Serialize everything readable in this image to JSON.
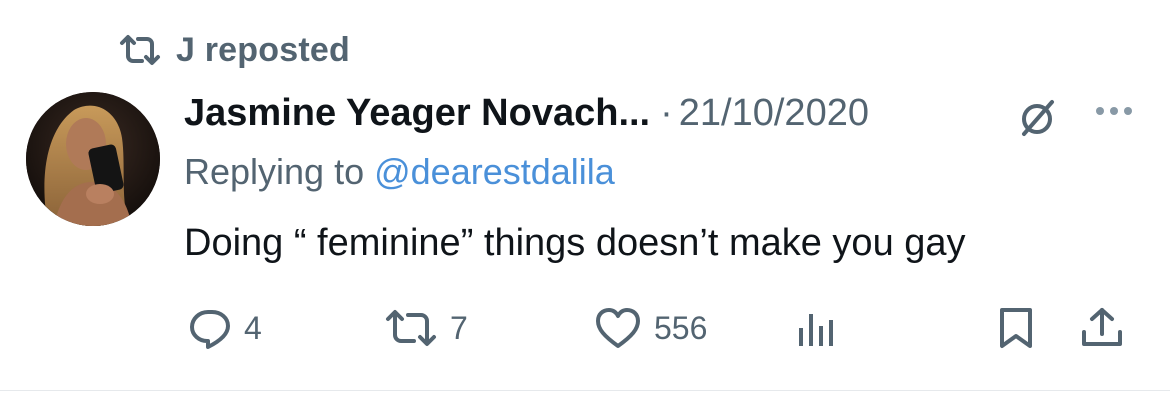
{
  "repost": {
    "label": "J reposted",
    "icon": "repost-icon"
  },
  "author": {
    "name": "Jasmine Yeager Novach...",
    "separator": "·",
    "date": "21/10/2020",
    "avatar": "avatar-photo",
    "badge_icon": "no-symbol-icon"
  },
  "reply": {
    "prefix": "Replying to",
    "handle": "@dearestdalila"
  },
  "tweet": {
    "text": "Doing “ feminine” things doesn’t make you gay"
  },
  "actions": {
    "reply_count": "4",
    "repost_count": "7",
    "like_count": "556"
  },
  "colors": {
    "text": "#0f1419",
    "muted": "#536471",
    "link": "#4a90d9",
    "divider": "#e6e9ec"
  }
}
